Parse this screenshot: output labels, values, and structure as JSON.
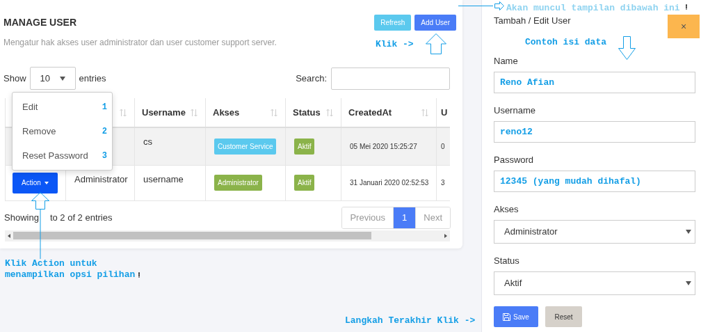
{
  "notes": {
    "top_note": "Akan muncul tampilan dibawah ini",
    "add_user_hint": "Klik ->",
    "form_hint": "Contoh isi data",
    "action_hint": "Klik Action untuk menampilkan opsi pilihan",
    "save_hint": "Langkah Terakhir Klik ->"
  },
  "page": {
    "title": "MANAGE USER",
    "subtitle": "Mengatur hak akses user administrator dan user customer support server.",
    "buttons": [
      {
        "label": "Refresh",
        "kind": "info"
      },
      {
        "label": "Add User",
        "kind": "primary"
      }
    ],
    "show_label": "Show",
    "page_length": "10",
    "entries_label": "entries",
    "search_label": "Search:"
  },
  "table": {
    "columns": [
      {
        "kind": "blank"
      },
      {
        "kind": "sort"
      },
      {
        "kind": "sort",
        "label": "Username"
      },
      {
        "kind": "sort",
        "label": "Akses"
      },
      {
        "kind": "sort",
        "label": "Status"
      },
      {
        "kind": "sort",
        "label": "CreatedAt"
      },
      {
        "kind": "plain",
        "label": "U"
      }
    ],
    "rows": [
      {
        "highlighted": true,
        "username": "cs",
        "akses": {
          "label": "Customer Service",
          "color": "#5bc9ee"
        },
        "status": {
          "label": "Aktif",
          "color": "#8bb34a"
        },
        "created_at": "05 Mei 2020 15:25:27",
        "column_7": "0"
      },
      {
        "highlighted": false,
        "action": "Action",
        "name": "Administrator",
        "username": "username",
        "akses": {
          "label": "Administrator",
          "color": "#8bb34a"
        },
        "status": {
          "label": "Aktif",
          "color": "#8bb34a"
        },
        "created_at": "31 Januari 2020 02:52:53",
        "column_7": "3"
      }
    ],
    "menu": [
      {
        "label": "Edit",
        "number": "1"
      },
      {
        "label": "Remove",
        "number": "2"
      },
      {
        "label": "Reset Password",
        "number": "3"
      }
    ],
    "info_parts": [
      "Showing",
      "to 2 of 2 entries"
    ],
    "pagination": [
      {
        "label": "Previous",
        "selected": false,
        "disabled": true
      },
      {
        "label": "1",
        "selected": true,
        "disabled": false
      },
      {
        "label": "Next",
        "selected": false,
        "disabled": true
      }
    ]
  },
  "form": {
    "title": "Tambah / Edit User",
    "close": "×",
    "fields": [
      {
        "label": "Name",
        "kind": "text",
        "value": "Reno Afian"
      },
      {
        "label": "Username",
        "kind": "text",
        "value": "reno12"
      },
      {
        "label": "Password",
        "kind": "text",
        "value": "12345 (yang mudah dihafal)"
      },
      {
        "label": "Akses",
        "kind": "select",
        "value": "Administrator"
      },
      {
        "label": "Status",
        "kind": "select",
        "value": "Aktif"
      }
    ],
    "buttons": [
      {
        "label": "Save",
        "kind": "save"
      },
      {
        "label": "Reset",
        "kind": "reset"
      }
    ]
  }
}
